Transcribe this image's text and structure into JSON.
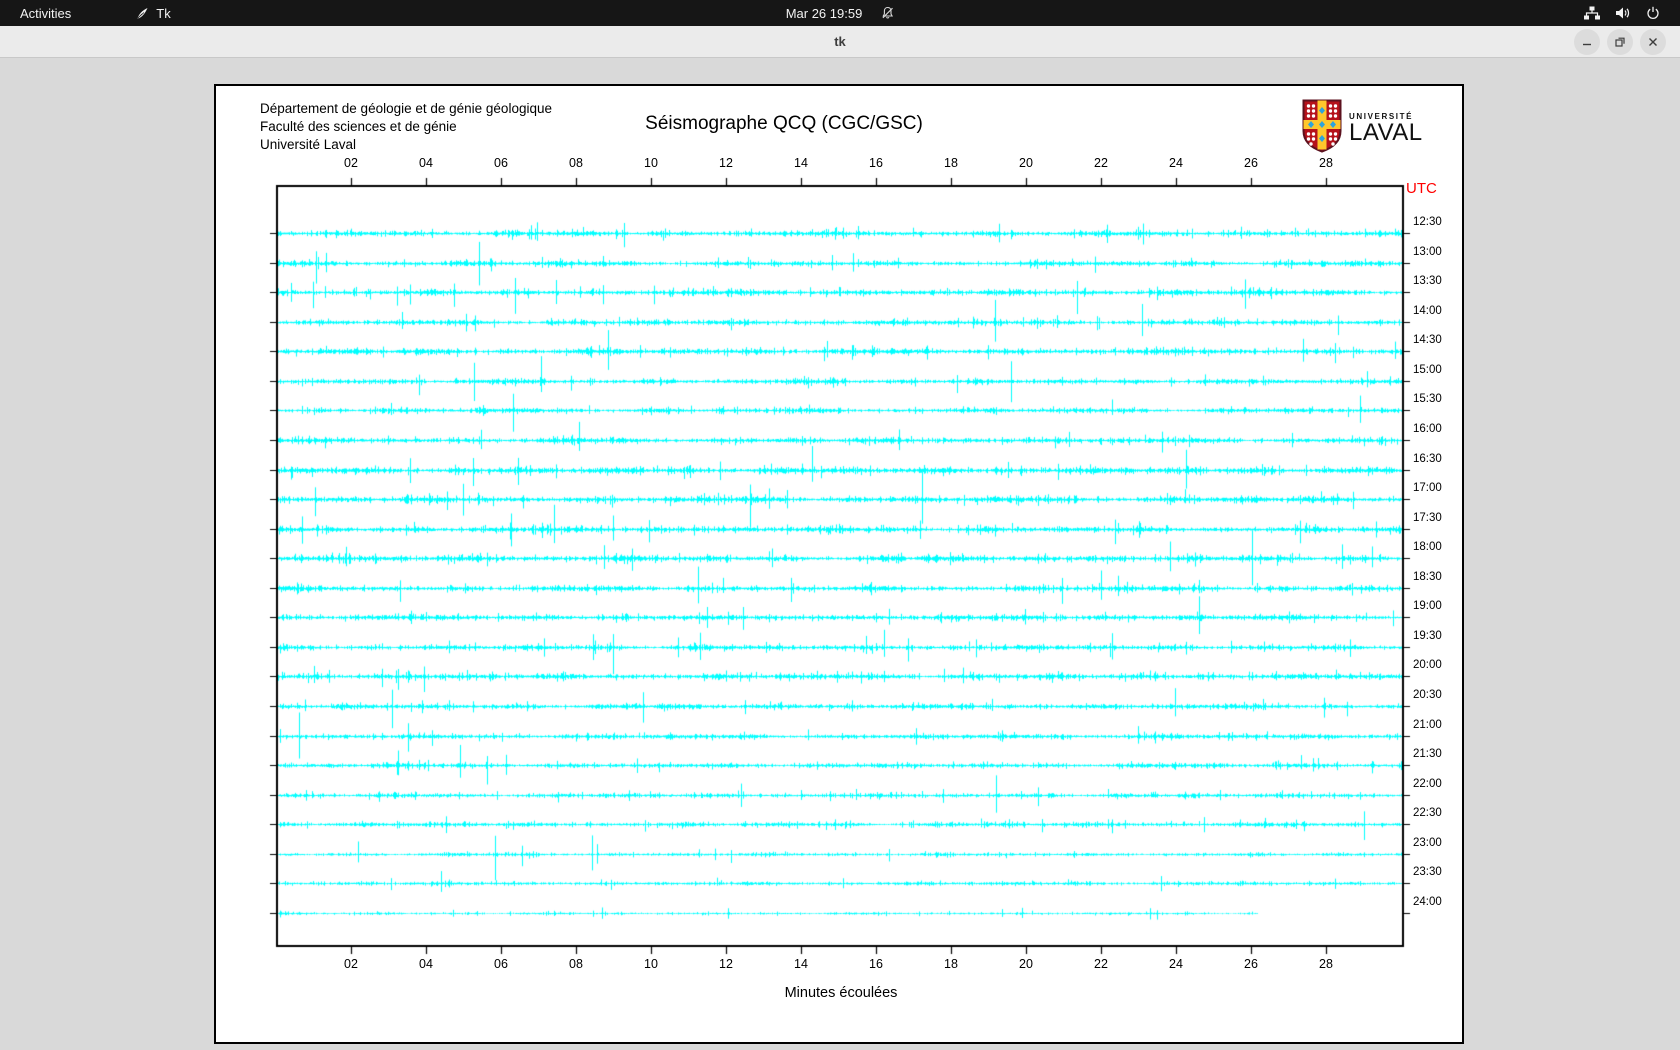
{
  "topbar": {
    "activities_label": "Activities",
    "app_name": "Tk",
    "clock": "Mar 26 19:59"
  },
  "titlebar": {
    "title": "tk"
  },
  "panel": {
    "dept_lines": [
      "Département de géologie et de génie géologique",
      "Faculté des sciences et de génie",
      "Université Laval"
    ],
    "logo": {
      "top": "UNIVERSITÉ",
      "bottom": "LAVAL",
      "shield_red": "#b5121b",
      "shield_gold": "#ffc72c",
      "shield_blue": "#2fa3dc"
    },
    "utc_label": "UTC",
    "utc_color": "#ff0000"
  },
  "chart_data": {
    "type": "line",
    "subtype": "helicorder-seismogram",
    "title": "Séismographe QCQ (CGC/GSC)",
    "xlabel": "Minutes écoulées",
    "x_tick_labels": [
      "02",
      "04",
      "06",
      "08",
      "10",
      "12",
      "14",
      "16",
      "18",
      "20",
      "22",
      "24",
      "26",
      "28"
    ],
    "x_minutes_range": [
      0,
      30
    ],
    "right_axis_title": "UTC",
    "trace_color": "#00ffff",
    "axis_color": "#000000",
    "note": "24 half-hour traces; the 24:00 trace ends at ~28.5 min",
    "rows": [
      {
        "utc": "12:30",
        "activity": 1.0
      },
      {
        "utc": "13:00",
        "activity": 1.0
      },
      {
        "utc": "13:30",
        "activity": 1.05
      },
      {
        "utc": "14:00",
        "activity": 0.95
      },
      {
        "utc": "14:30",
        "activity": 1.1
      },
      {
        "utc": "15:00",
        "activity": 0.95
      },
      {
        "utc": "15:30",
        "activity": 0.9
      },
      {
        "utc": "16:00",
        "activity": 1.0
      },
      {
        "utc": "16:30",
        "activity": 1.2
      },
      {
        "utc": "17:00",
        "activity": 1.15
      },
      {
        "utc": "17:30",
        "activity": 1.1
      },
      {
        "utc": "18:00",
        "activity": 1.15
      },
      {
        "utc": "18:30",
        "activity": 1.0
      },
      {
        "utc": "19:00",
        "activity": 1.05
      },
      {
        "utc": "19:30",
        "activity": 0.95
      },
      {
        "utc": "20:00",
        "activity": 1.1
      },
      {
        "utc": "20:30",
        "activity": 1.0
      },
      {
        "utc": "21:00",
        "activity": 0.95
      },
      {
        "utc": "21:30",
        "activity": 0.9
      },
      {
        "utc": "22:00",
        "activity": 0.8
      },
      {
        "utc": "22:30",
        "activity": 0.85
      },
      {
        "utc": "23:00",
        "activity": 0.6
      },
      {
        "utc": "23:30",
        "activity": 0.65
      },
      {
        "utc": "24:00",
        "activity": 0.4,
        "end_fraction": 0.87
      }
    ]
  }
}
